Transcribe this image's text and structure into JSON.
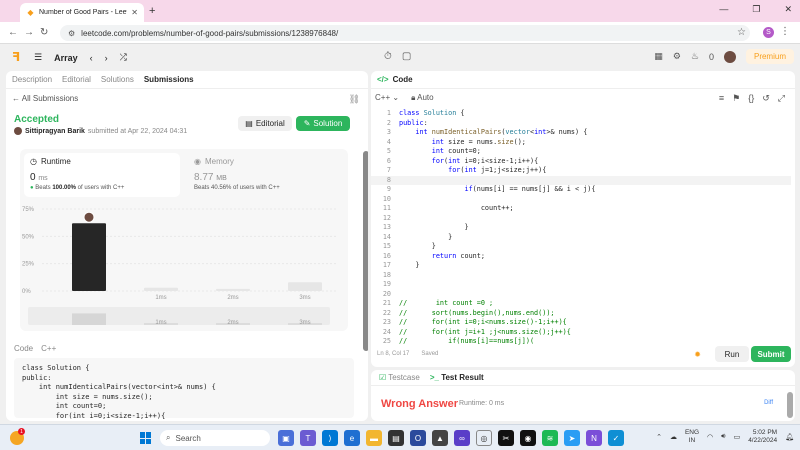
{
  "browser": {
    "tab_title": "Number of Good Pairs - LeetC",
    "url": "leetcode.com/problems/number-of-good-pairs/submissions/1238976848/",
    "profile_letter": "S"
  },
  "nav": {
    "problem_list_label": "Array",
    "streak_count": "0",
    "premium_label": "Premium"
  },
  "left": {
    "tabs": [
      "Description",
      "Editorial",
      "Solutions",
      "Submissions"
    ],
    "all_submissions": "All Submissions",
    "status": "Accepted",
    "user": "Sittipragyan Barik",
    "submitted_at": "submitted at Apr 22, 2024 04:31",
    "editorial_btn": "Editorial",
    "solution_btn": "Solution",
    "runtime": {
      "title": "Runtime",
      "value": "0",
      "unit": "ms",
      "beats_prefix": "Beats",
      "beats_pct": "100.00%",
      "beats_suffix": "of users with C++"
    },
    "memory": {
      "title": "Memory",
      "value": "8.77",
      "unit": "MB",
      "beats_text": "Beats 40.56% of users with C++"
    },
    "code_label": "Code",
    "code_lang": "C++",
    "code_preview": "class Solution {\npublic:\n    int numIdenticalPairs(vector<int>& nums) {\n        int size = nums.size();\n        int count=0;\n        for(int i=0;i<size-1;i++){"
  },
  "chart_data": {
    "type": "bar",
    "categories": [
      "0ms",
      "1ms",
      "2ms",
      "3ms"
    ],
    "x_tick_labels": [
      "1ms",
      "2ms",
      "3ms"
    ],
    "values": [
      62,
      3,
      2,
      8
    ],
    "y_ticks": [
      "75%",
      "50%",
      "25%",
      "0%"
    ],
    "ylim": [
      0,
      75
    ],
    "highlight_index": 0,
    "colors": {
      "highlight": "#262626",
      "other": "#e6e6e6"
    }
  },
  "right": {
    "header": "Code",
    "lang": "C++",
    "mode": "Auto",
    "status": "Ln 8, Col 17",
    "saved": "Saved",
    "run_btn": "Run",
    "submit_btn": "Submit",
    "code_lines": [
      "class Solution {",
      "public:",
      "    int numIdenticalPairs(vector<int>& nums) {",
      "        int size = nums.size();",
      "        int count=0;",
      "        for(int i=0;i<size-1;i++){",
      "            for(int j=1;j<size;j++){",
      "",
      "                if(nums[i] == nums[j] && i < j){",
      "",
      "                    count++;",
      "",
      "                }",
      "            }",
      "        }",
      "        return count;",
      "    }",
      "",
      "",
      "",
      "//       int count =0 ;",
      "//      sort(nums.begin(),nums.end());",
      "//      for(int i=0;i<nums.size()-1;i++){",
      "//      for(int j=i+1 ;j<nums.size();j++){",
      "//          if(nums[i]==nums[j])("
    ]
  },
  "bottom": {
    "tabs": [
      "Testcase",
      "Test Result"
    ],
    "verdict": "Wrong Answer",
    "runtime_text": "Runtime: 0 ms",
    "diff_label": "Diff"
  },
  "taskbar": {
    "search_placeholder": "Search",
    "weather_badge": "1",
    "lang_line1": "ENG",
    "lang_line2": "IN",
    "time": "5:02 PM",
    "date": "4/22/2024"
  }
}
